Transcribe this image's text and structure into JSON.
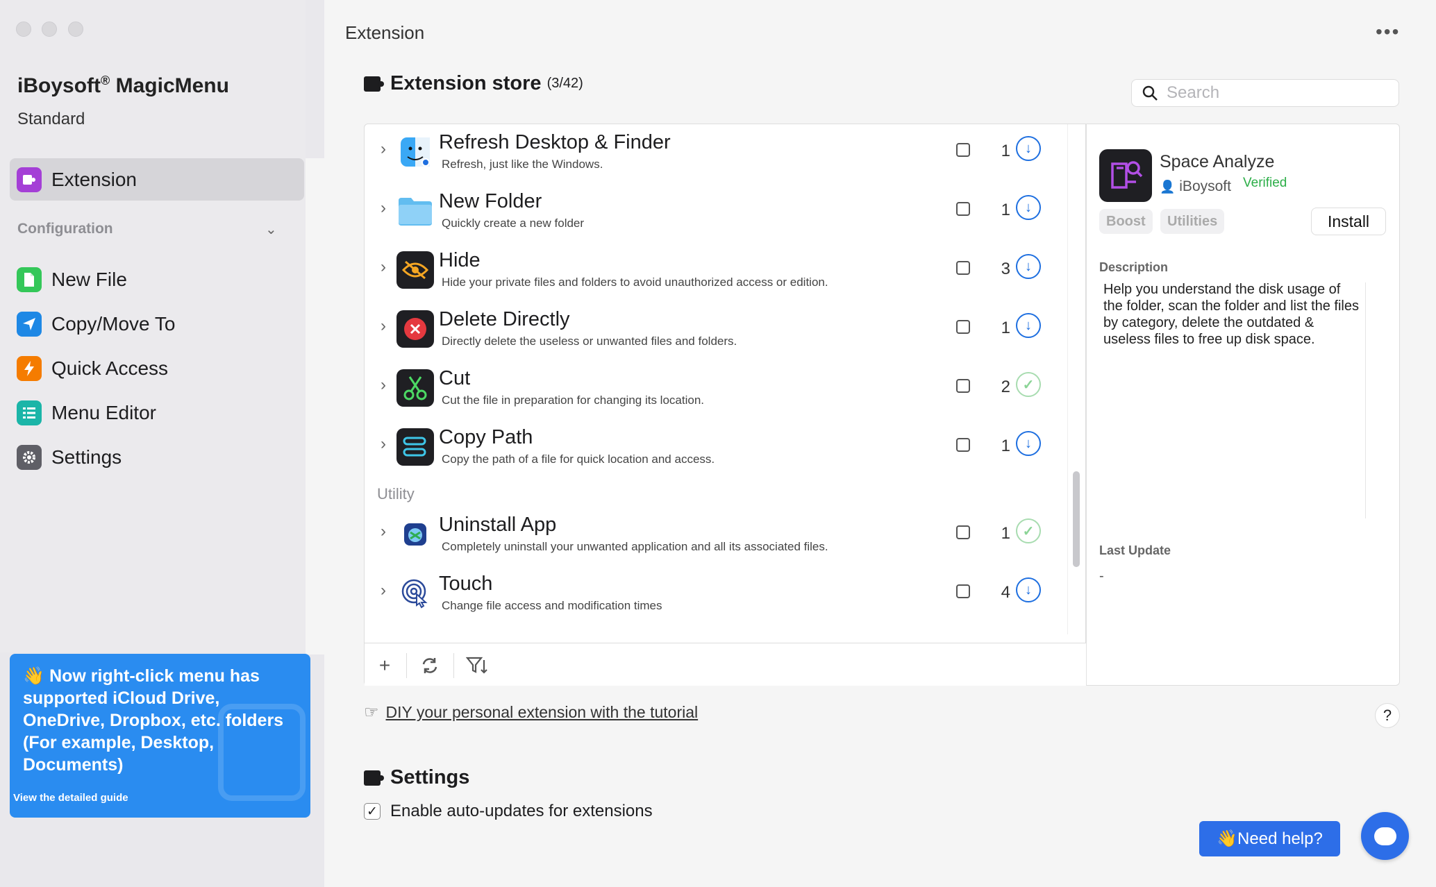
{
  "sidebar": {
    "app_name": "iBoysoft",
    "app_name_suffix": "MagicMenu",
    "registered_mark": "®",
    "plan": "Standard",
    "active_item": "Extension",
    "config_header": "Configuration",
    "items": [
      {
        "label": "New File",
        "icon": "new-file-icon",
        "color": "#34c759"
      },
      {
        "label": "Copy/Move To",
        "icon": "send-icon",
        "color": "#1e88e5"
      },
      {
        "label": "Quick Access",
        "icon": "bolt-icon",
        "color": "#f57c00"
      },
      {
        "label": "Menu Editor",
        "icon": "list-icon",
        "color": "#1bb5a8"
      },
      {
        "label": "Settings",
        "icon": "gear-icon",
        "color": "#5f5f66"
      }
    ],
    "promo": {
      "text": "👋 Now right-click menu has supported iCloud Drive, OneDrive, Dropbox, etc. folders (For example, Desktop, Documents)",
      "link": "View the detailed guide"
    }
  },
  "header": {
    "title": "Extension",
    "more_icon": "more-icon"
  },
  "store": {
    "title": "Extension store",
    "count": "(3/42)",
    "search_placeholder": "Search",
    "extensions": [
      {
        "name": "Refresh Desktop & Finder",
        "desc": "Refresh, just like the Windows.",
        "count": "1",
        "status": "download",
        "icon": "finder-icon"
      },
      {
        "name": "New Folder",
        "desc": "Quickly create a new folder",
        "count": "1",
        "status": "download",
        "icon": "folder-icon"
      },
      {
        "name": "Hide",
        "desc": "Hide your private files and folders to avoid unauthorized access or edition.",
        "count": "3",
        "status": "download",
        "icon": "eye-slash-icon"
      },
      {
        "name": "Delete Directly",
        "desc": "Directly delete the useless or unwanted files and folders.",
        "count": "1",
        "status": "download",
        "icon": "delete-icon"
      },
      {
        "name": "Cut",
        "desc": "Cut the file in preparation for changing its location.",
        "count": "2",
        "status": "installed",
        "icon": "scissors-icon"
      },
      {
        "name": "Copy Path",
        "desc": "Copy the path of a file for quick location and access.",
        "count": "1",
        "status": "download",
        "icon": "copy-path-icon"
      }
    ],
    "group_label": "Utility",
    "utility_extensions": [
      {
        "name": "Uninstall App",
        "desc": "Completely uninstall your unwanted application and all its associated files.",
        "count": "1",
        "status": "installed",
        "icon": "uninstall-icon"
      },
      {
        "name": "Touch",
        "desc": "Change file access and modification times",
        "count": "4",
        "status": "download",
        "icon": "fingerprint-icon"
      }
    ],
    "diy_text": "DIY your personal extension with the tutorial"
  },
  "detail": {
    "name": "Space Analyze",
    "author": "iBoysoft",
    "verified": "Verified",
    "tags": [
      "Boost",
      "Utilities"
    ],
    "install_label": "Install",
    "description_label": "Description",
    "description": "Help you understand the disk usage of the folder, scan the folder and list the files by category, delete the outdated & useless files to free up disk space.",
    "last_update_label": "Last Update",
    "last_update_value": "-"
  },
  "settings": {
    "title": "Settings",
    "auto_update_label": "Enable auto-updates for extensions",
    "auto_update_checked": true
  },
  "support": {
    "need_help": "👋Need help?",
    "help_q": "?"
  },
  "colors": {
    "accent": "#1e6fe0",
    "promo": "#2a8cf0",
    "verified": "#2cae48"
  }
}
